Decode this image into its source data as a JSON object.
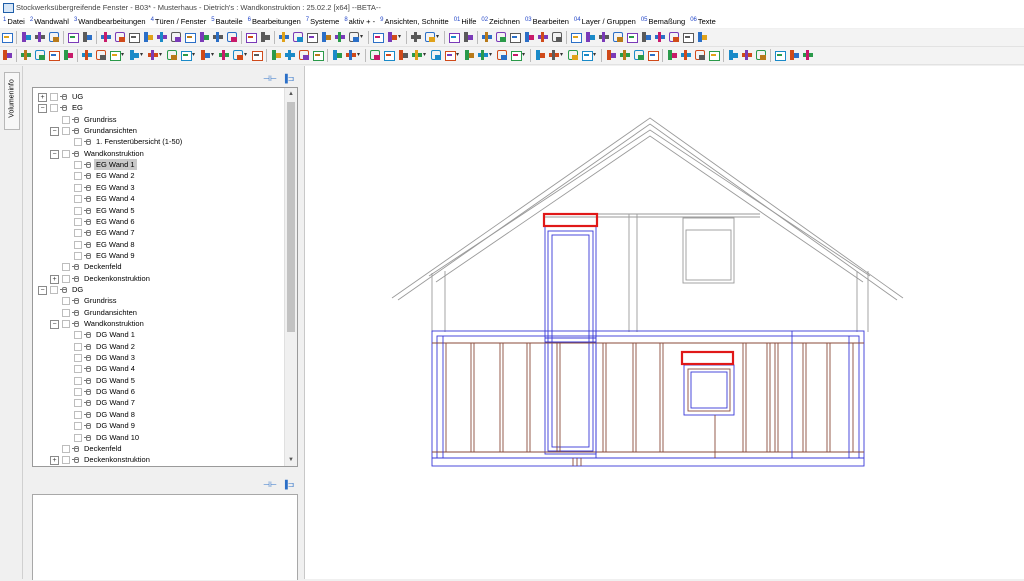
{
  "window": {
    "title": "Stockwerksübergreifende Fenster - B03* - Musterhaus - Dietrich's : Wandkonstruktion : 25.02.2 [x64] --BETA--"
  },
  "menu": [
    {
      "num": "1",
      "label": "Datei"
    },
    {
      "num": "2",
      "label": "Wandwahl"
    },
    {
      "num": "3",
      "label": "Wandbearbeitungen"
    },
    {
      "num": "4",
      "label": "Türen / Fenster"
    },
    {
      "num": "5",
      "label": "Bauteile"
    },
    {
      "num": "6",
      "label": "Bearbeitungen"
    },
    {
      "num": "7",
      "label": "Systeme"
    },
    {
      "num": "8",
      "label": "aktiv + -"
    },
    {
      "num": "9",
      "label": "Ansichten, Schnitte"
    },
    {
      "num": "01",
      "label": "Hilfe"
    },
    {
      "num": "02",
      "label": "Zeichnen"
    },
    {
      "num": "03",
      "label": "Bearbeiten"
    },
    {
      "num": "04",
      "label": "Layer / Gruppen"
    },
    {
      "num": "05",
      "label": "Bemaßung"
    },
    {
      "num": "06",
      "label": "Texte"
    }
  ],
  "sidebar_tab": {
    "label": "Volumeninfo"
  },
  "panel": {
    "pin_icon": "pin-icon",
    "close_icon": "dock-close-icon"
  },
  "tree": [
    {
      "level": 0,
      "expander": "+",
      "label": "UG"
    },
    {
      "level": 0,
      "expander": "-",
      "label": "EG"
    },
    {
      "level": 1,
      "expander": "",
      "label": "Grundriss"
    },
    {
      "level": 1,
      "expander": "-",
      "label": "Grundansichten"
    },
    {
      "level": 2,
      "expander": "",
      "label": "1. Fensterübersicht (1-50)"
    },
    {
      "level": 1,
      "expander": "-",
      "label": "Wandkonstruktion"
    },
    {
      "level": 2,
      "expander": "",
      "label": "EG Wand 1",
      "selected": true
    },
    {
      "level": 2,
      "expander": "",
      "label": "EG Wand 2"
    },
    {
      "level": 2,
      "expander": "",
      "label": "EG Wand 3"
    },
    {
      "level": 2,
      "expander": "",
      "label": "EG Wand 4"
    },
    {
      "level": 2,
      "expander": "",
      "label": "EG Wand 5"
    },
    {
      "level": 2,
      "expander": "",
      "label": "EG Wand 6"
    },
    {
      "level": 2,
      "expander": "",
      "label": "EG Wand 7"
    },
    {
      "level": 2,
      "expander": "",
      "label": "EG Wand 8"
    },
    {
      "level": 2,
      "expander": "",
      "label": "EG Wand 9"
    },
    {
      "level": 1,
      "expander": "",
      "label": "Deckenfeld"
    },
    {
      "level": 1,
      "expander": "+",
      "label": "Deckenkonstruktion"
    },
    {
      "level": 0,
      "expander": "-",
      "label": "DG"
    },
    {
      "level": 1,
      "expander": "",
      "label": "Grundriss"
    },
    {
      "level": 1,
      "expander": "",
      "label": "Grundansichten"
    },
    {
      "level": 1,
      "expander": "-",
      "label": "Wandkonstruktion"
    },
    {
      "level": 2,
      "expander": "",
      "label": "DG Wand 1"
    },
    {
      "level": 2,
      "expander": "",
      "label": "DG Wand 2"
    },
    {
      "level": 2,
      "expander": "",
      "label": "DG Wand 3"
    },
    {
      "level": 2,
      "expander": "",
      "label": "DG Wand 4"
    },
    {
      "level": 2,
      "expander": "",
      "label": "DG Wand 5"
    },
    {
      "level": 2,
      "expander": "",
      "label": "DG Wand 6"
    },
    {
      "level": 2,
      "expander": "",
      "label": "DG Wand 7"
    },
    {
      "level": 2,
      "expander": "",
      "label": "DG Wand 8"
    },
    {
      "level": 2,
      "expander": "",
      "label": "DG Wand 9"
    },
    {
      "level": 2,
      "expander": "",
      "label": "DG Wand 10"
    },
    {
      "level": 1,
      "expander": "",
      "label": "Deckenfeld"
    },
    {
      "level": 1,
      "expander": "+",
      "label": "Deckenkonstruktion"
    }
  ],
  "colors": {
    "wall_outline": "#3838d8",
    "stud": "#8a4a3a",
    "header_red": "#e01818",
    "gable_line": "#9a9a9a",
    "icon_blue": "#2b6fc7"
  }
}
